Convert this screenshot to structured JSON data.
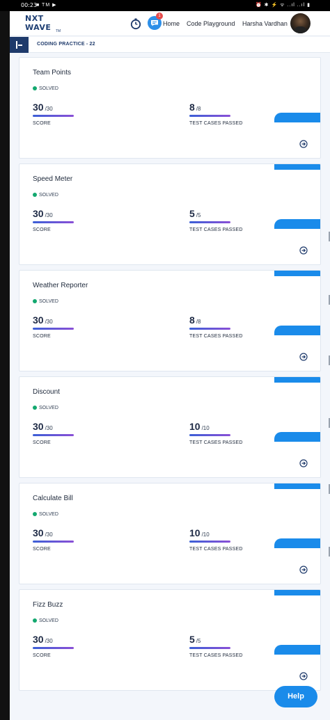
{
  "status_bar": {
    "time": "00:23",
    "left_icons": "■ TM ▶",
    "right_icons": "⏰ ✱ ⚡ ᯤ ..ıl ..ıl ▮"
  },
  "header": {
    "logo_line1": "NXT",
    "logo_line2": "WAVE",
    "logo_tm": "TM",
    "notification_count": "1",
    "nav": {
      "home": "Home",
      "playground": "Code Playground",
      "user": "Harsha Vardhan"
    }
  },
  "breadcrumb": "CODING PRACTICE - 22",
  "labels": {
    "solved": "SOLVED",
    "score": "SCORE",
    "tests": "TEST CASES PASSED"
  },
  "cards": [
    {
      "title": "Team Points",
      "status": "SOLVED",
      "score": "30",
      "score_total": "/30",
      "passed": "8",
      "passed_total": "/8"
    },
    {
      "title": "Speed Meter",
      "status": "SOLVED",
      "score": "30",
      "score_total": "/30",
      "passed": "5",
      "passed_total": "/5"
    },
    {
      "title": "Weather Reporter",
      "status": "SOLVED",
      "score": "30",
      "score_total": "/30",
      "passed": "8",
      "passed_total": "/8"
    },
    {
      "title": "Discount",
      "status": "SOLVED",
      "score": "30",
      "score_total": "/30",
      "passed": "10",
      "passed_total": "/10"
    },
    {
      "title": "Calculate Bill",
      "status": "SOLVED",
      "score": "30",
      "score_total": "/30",
      "passed": "10",
      "passed_total": "/10"
    },
    {
      "title": "Fizz Buzz",
      "status": "SOLVED",
      "score": "30",
      "score_total": "/30",
      "passed": "5",
      "passed_total": "/5"
    }
  ],
  "help_button": "Help",
  "colors": {
    "accent": "#1a8bea",
    "navy": "#1e3a6b",
    "solved": "#13a86f"
  }
}
